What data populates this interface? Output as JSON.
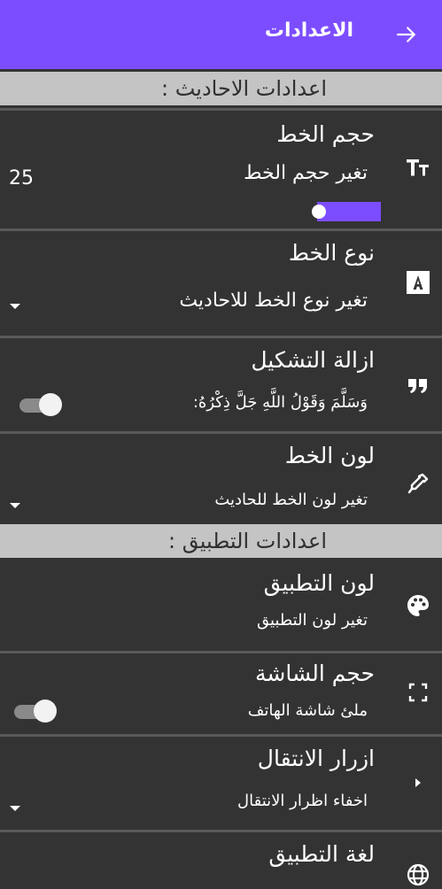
{
  "header": {
    "title": "الاعدادات",
    "back_icon": "arrow-right-icon",
    "background": "#7c4dff"
  },
  "sections": {
    "hadith": {
      "title": "اعدادات الاحاديث :"
    },
    "app": {
      "title": "اعدادات التطبيق :"
    }
  },
  "font_size": {
    "title": "حجم الخط",
    "subtitle": "تغير حجم الخط",
    "value": "25",
    "slider_fraction": 0.0,
    "icon": "text-size-icon"
  },
  "font_type": {
    "title": "نوع الخط",
    "subtitle": "تغير نوع الخط للاحاديث",
    "icon": "font-letter-icon"
  },
  "diacritics": {
    "title": "ازالة التشكيل",
    "subtitle": "وَسَلَّمَ وَقَوْلُ اللَّهِ جَلَّ ذِكْرُهُ:",
    "enabled": false,
    "icon": "quote-icon"
  },
  "font_color": {
    "title": "لون الخط",
    "subtitle": "تغير لون الخط للحاديث",
    "icon": "eyedropper-icon"
  },
  "app_color": {
    "title": "لون التطبيق",
    "subtitle": "تغير لون التطبيق",
    "icon": "palette-icon"
  },
  "screen_size": {
    "title": "حجم الشاشة",
    "subtitle": "ملئ شاشة الهاتف",
    "enabled": false,
    "icon": "fullscreen-icon"
  },
  "nav_buttons": {
    "title": "ازرار الانتقال",
    "subtitle": "اخفاء اظرار الانتقال",
    "icon": "play-arrow-icon"
  },
  "app_language": {
    "title": "لغة التطبيق",
    "icon": "globe-icon"
  }
}
